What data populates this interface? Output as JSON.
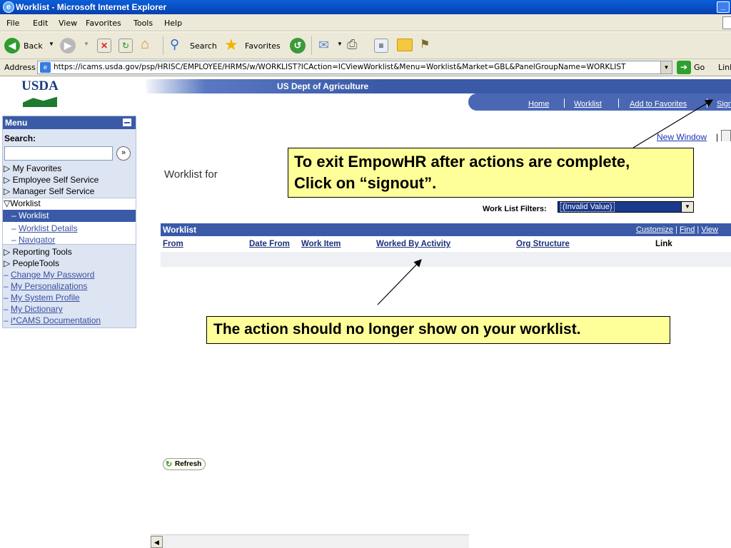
{
  "window": {
    "title": "Worklist - Microsoft Internet Explorer",
    "min_glyph": "_"
  },
  "menubar": {
    "items": [
      "File",
      "Edit",
      "View",
      "Favorites",
      "Tools",
      "Help"
    ]
  },
  "toolbar": {
    "back": "Back",
    "search": "Search",
    "favorites": "Favorites"
  },
  "addressbar": {
    "label": "Address",
    "url": "https://icams.usda.gov/psp/HRISC/EMPLOYEE/HRMS/w/WORKLIST?ICAction=ICViewWorklist&Menu=Worklist&Market=GBL&PanelGroupName=WORKLIST",
    "go": "Go",
    "links": "Link"
  },
  "header": {
    "logo": "USDA",
    "org": "US Dept of Agriculture",
    "nav": [
      "Home",
      "Worklist",
      "Add to Favorites",
      "Sign"
    ]
  },
  "menu": {
    "title": "Menu",
    "search_label": "Search:",
    "items": [
      {
        "prefix": "▷ ",
        "label": "My Favorites"
      },
      {
        "prefix": "▷ ",
        "label": "Employee Self Service"
      },
      {
        "prefix": "▷ ",
        "label": "Manager Self Service"
      },
      {
        "prefix": "▽",
        "label": "Worklist"
      },
      {
        "prefix": "– ",
        "label": "Worklist"
      },
      {
        "prefix": "– ",
        "label": "Worklist Details"
      },
      {
        "prefix": "– ",
        "label": "Navigator"
      },
      {
        "prefix": "▷ ",
        "label": "Reporting Tools"
      },
      {
        "prefix": "▷ ",
        "label": "PeopleTools"
      },
      {
        "prefix": "– ",
        "label": "Change My Password"
      },
      {
        "prefix": "– ",
        "label": "My Personalizations"
      },
      {
        "prefix": "– ",
        "label": "My System Profile"
      },
      {
        "prefix": "– ",
        "label": "My Dictionary"
      },
      {
        "prefix": "– ",
        "label": "i*CAMS Documentation"
      }
    ]
  },
  "content": {
    "new_window": "New Window",
    "new_window_sep": "|",
    "worklist_for": "Worklist for",
    "filter_label": "Work List Filters:",
    "filter_value": "(Invalid Value)",
    "grid_title": "Worklist",
    "grid_tools": {
      "customize": "Customize",
      "sep": "|",
      "find": "Find",
      "view": "View"
    },
    "columns": [
      "From",
      "Date From",
      "Work Item",
      "Worked By Activity",
      "Org Structure",
      "Link"
    ],
    "refresh": "Refresh"
  },
  "callouts": {
    "signout_line1": "To exit EmpowHR after actions are complete,",
    "signout_line2": "Click on “signout”.",
    "worklist_note": "The action should no longer show on your worklist."
  },
  "colors": {
    "callout_bg": "#ffff99",
    "header_blue": "#3a5aa8",
    "title_blue": "#0a5fd8"
  }
}
